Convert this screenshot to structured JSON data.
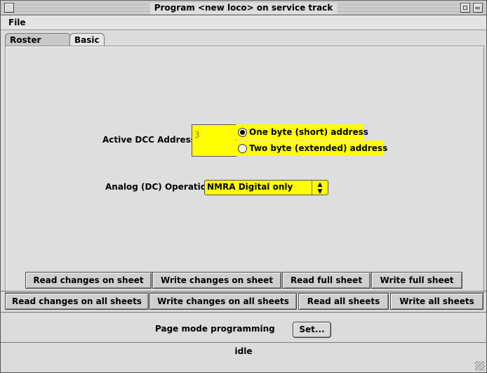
{
  "window": {
    "title": "Program <new loco> on service track"
  },
  "menu": {
    "items": [
      "File"
    ]
  },
  "tabs": [
    {
      "label": "Roster Entry",
      "active": false
    },
    {
      "label": "Basic",
      "active": true
    }
  ],
  "basic": {
    "address_label": "Active DCC Address:",
    "address_value": "3",
    "radio_short": "One byte (short) address",
    "radio_long": "Two byte (extended) address",
    "radio_selected": "short",
    "analog_label": "Analog (DC) Operation",
    "analog_value": "NMRA Digital only",
    "highlight_color": "#ffff00"
  },
  "sheet_buttons": {
    "read_changes": "Read changes on sheet",
    "write_changes": "Write changes on sheet",
    "read_full": "Read full sheet",
    "write_full": "Write full sheet"
  },
  "all_buttons": {
    "read_changes_all": "Read changes on all sheets",
    "write_changes_all": "Write changes on all sheets",
    "read_all": "Read all sheets",
    "write_all": "Write all sheets"
  },
  "programming": {
    "mode_label": "Page mode programming",
    "set_label": "Set..."
  },
  "status": {
    "text": "idle"
  }
}
